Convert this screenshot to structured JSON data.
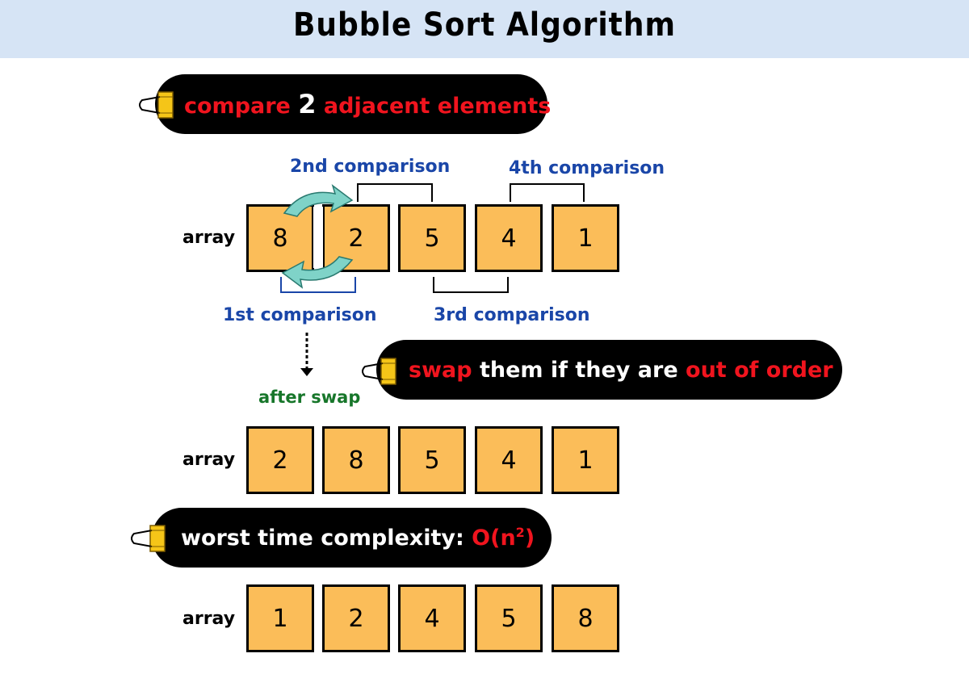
{
  "header": {
    "title": "Bubble Sort Algorithm",
    "background": "#d6e4f5"
  },
  "callouts": {
    "compare": {
      "parts": [
        {
          "text": "compare ",
          "color": "red"
        },
        {
          "text": "2",
          "color": "white"
        },
        {
          "text": " adjacent elements",
          "color": "red"
        }
      ]
    },
    "swap": {
      "parts": [
        {
          "text": "swap",
          "color": "red"
        },
        {
          "text": " them if they are ",
          "color": "white"
        },
        {
          "text": "out of order",
          "color": "red"
        }
      ]
    },
    "complexity": {
      "label": "worst time complexity: ",
      "value_prefix": "O(n",
      "superscript": "2",
      "value_suffix": ")"
    }
  },
  "arrays": [
    {
      "label": "array",
      "values": [
        "8",
        "2",
        "5",
        "4",
        "1"
      ]
    },
    {
      "label": "array",
      "values": [
        "2",
        "8",
        "5",
        "4",
        "1"
      ]
    },
    {
      "label": "array",
      "values": [
        "1",
        "2",
        "4",
        "5",
        "8"
      ]
    }
  ],
  "comparisons": {
    "first": "1st comparison",
    "second": "2nd comparison",
    "third": "3rd comparison",
    "fourth": "4th comparison"
  },
  "after_swap": "after swap",
  "colors": {
    "box_fill": "#fbbd59",
    "accent_red": "#f0141e",
    "comparison_blue": "#1a46a8",
    "after_green": "#17762a",
    "swap_arrow": "#7fd3c8",
    "clip_yellow": "#f5c518"
  }
}
